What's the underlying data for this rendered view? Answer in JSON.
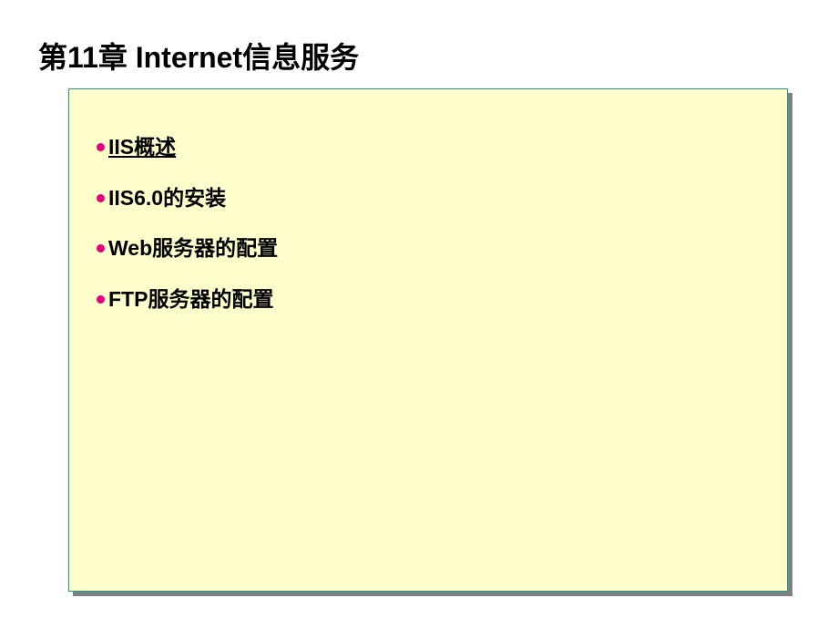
{
  "slide": {
    "title": "第11章  Internet信息服务",
    "bullets": [
      {
        "text": "IIS概述",
        "underline": true
      },
      {
        "text": "IIS6.0的安装",
        "underline": false
      },
      {
        "text": "Web服务器的配置",
        "underline": false
      },
      {
        "text": "FTP服务器的配置",
        "underline": false
      }
    ]
  },
  "colors": {
    "bullet": "#e6007e",
    "box_bg": "#fdfdcc",
    "box_border": "#1a9a8f",
    "shadow": "#808080"
  }
}
